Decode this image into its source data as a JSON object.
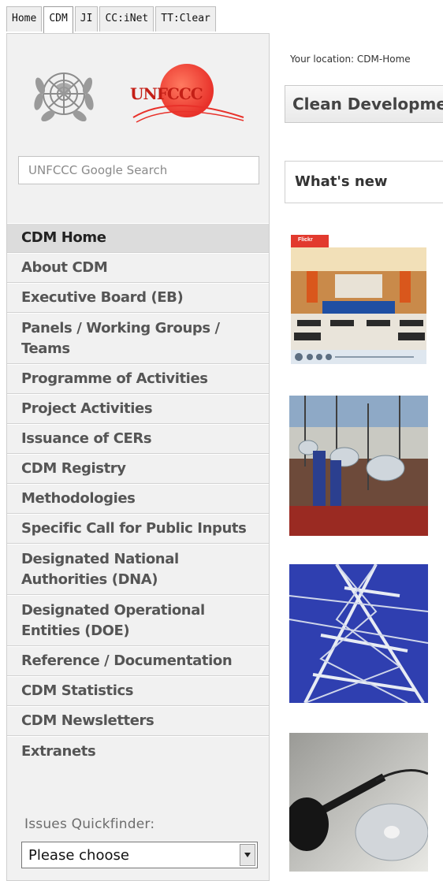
{
  "tabs": [
    {
      "label": "Home"
    },
    {
      "label": "CDM"
    },
    {
      "label": "JI"
    },
    {
      "label": "CC:iNet"
    },
    {
      "label": "TT:Clear"
    }
  ],
  "sidebar": {
    "search": {
      "placeholder": "UNFCCC Google Search"
    },
    "logo_text": "UNFCCC",
    "nav": [
      {
        "label": "CDM Home"
      },
      {
        "label": "About CDM"
      },
      {
        "label": "Executive Board (EB)"
      },
      {
        "label": "Panels / Working Groups / Teams"
      },
      {
        "label": "Programme of Activities"
      },
      {
        "label": "Project Activities"
      },
      {
        "label": "Issuance of CERs"
      },
      {
        "label": "CDM Registry"
      },
      {
        "label": "Methodologies"
      },
      {
        "label": "Specific Call for Public Inputs"
      },
      {
        "label": "Designated National Authorities (DNA)"
      },
      {
        "label": "Designated Operational Entities (DOE)"
      },
      {
        "label": "Reference / Documentation"
      },
      {
        "label": "CDM Statistics"
      },
      {
        "label": "CDM Newsletters"
      },
      {
        "label": "Extranets"
      }
    ],
    "quickfinder": {
      "label": "Issues Quickfinder:",
      "selected": "Please choose"
    }
  },
  "content": {
    "location": "Your location: CDM-Home",
    "title": "Clean Development Mechanism",
    "whats_new": "What's new",
    "flickr_badge": "Flickr"
  },
  "colors": {
    "accent_red": "#e8312a",
    "sidebar_bg": "#f1f1f1"
  }
}
